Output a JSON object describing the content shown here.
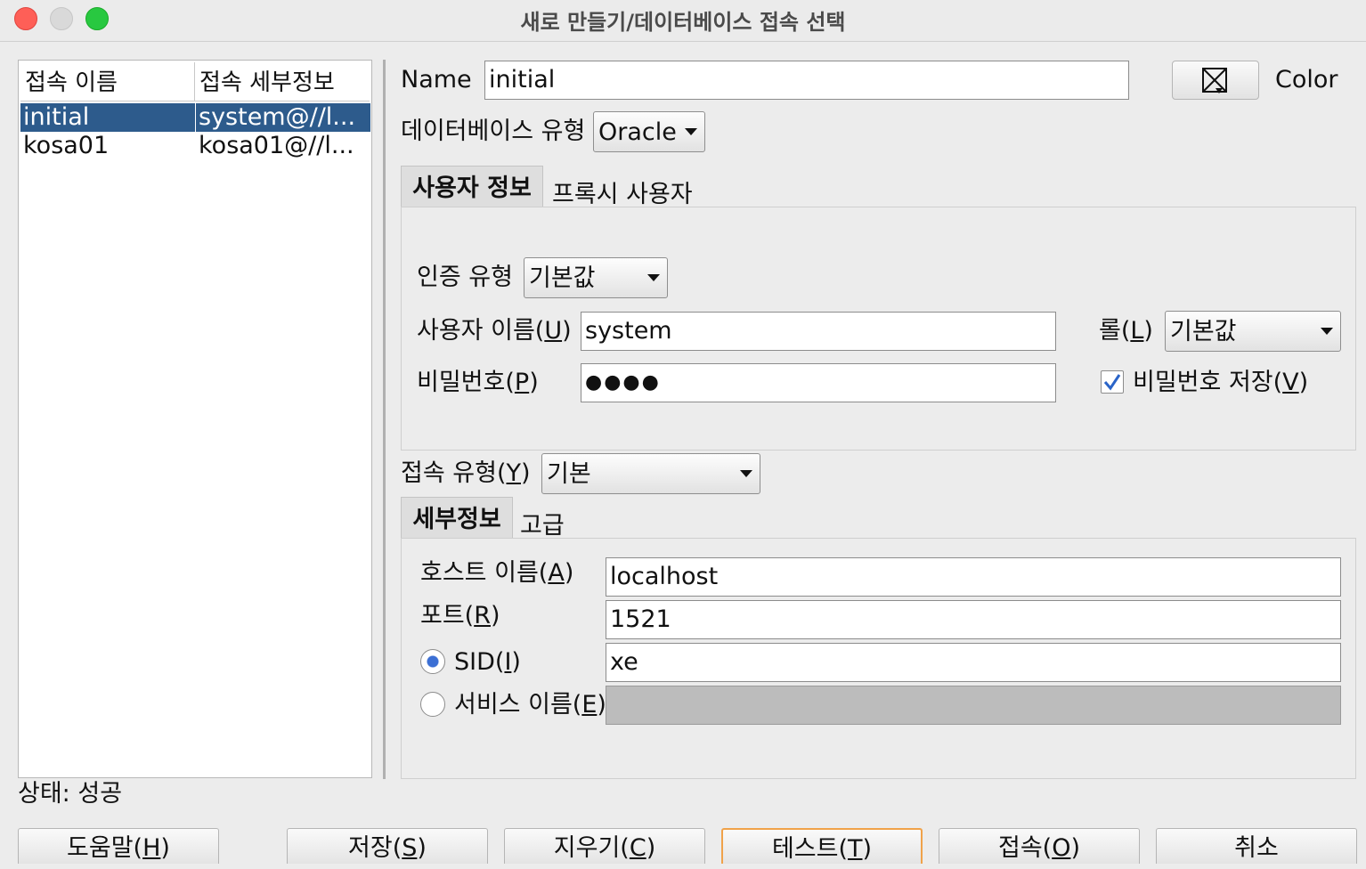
{
  "window": {
    "title": "새로 만들기/데이터베이스 접속 선택"
  },
  "list": {
    "headers": [
      "접속 이름",
      "접속 세부정보"
    ],
    "rows": [
      {
        "name": "initial",
        "details": "system@//l..."
      },
      {
        "name": "kosa01",
        "details": "kosa01@//l..."
      }
    ],
    "selected_index": 0
  },
  "status": "상태: 성공",
  "form": {
    "name_label": "Name",
    "name_value": "initial",
    "color_label": "Color",
    "db_type_label": "데이터베이스 유형",
    "db_type_value": "Oracle",
    "tabs_user": [
      "사용자 정보",
      "프록시 사용자"
    ],
    "auth_type_label": "인증 유형",
    "auth_type_value": "기본값",
    "username_label": "사용자 이름(",
    "username_mnemonic": "U",
    "username_value": "system",
    "role_label": "롤(",
    "role_mnemonic": "L",
    "role_value": "기본값",
    "password_label": "비밀번호(",
    "password_mnemonic": "P",
    "password_value": "●●●●",
    "save_password_label": "비밀번호 저장(",
    "save_password_mnemonic": "V",
    "save_password_checked": true,
    "conn_type_label": "접속 유형(",
    "conn_type_mnemonic": "Y",
    "conn_type_value": "기본",
    "tabs_conn": [
      "세부정보",
      "고급"
    ],
    "host_label": "호스트 이름(",
    "host_mnemonic": "A",
    "host_value": "localhost",
    "port_label": "포트(",
    "port_mnemonic": "R",
    "port_value": "1521",
    "sid_label": "SID(",
    "sid_mnemonic": "I",
    "sid_value": "xe",
    "sid_selected": true,
    "service_label": "서비스 이름(",
    "service_mnemonic": "E",
    "service_value": ""
  },
  "buttons": {
    "help": {
      "label": "도움말(",
      "m": "H"
    },
    "save": {
      "label": "저장(",
      "m": "S"
    },
    "clear": {
      "label": "지우기(",
      "m": "C"
    },
    "test": {
      "label": "테스트(",
      "m": "T"
    },
    "connect": {
      "label": "접속(",
      "m": "O"
    },
    "cancel": {
      "label": "취소"
    }
  }
}
